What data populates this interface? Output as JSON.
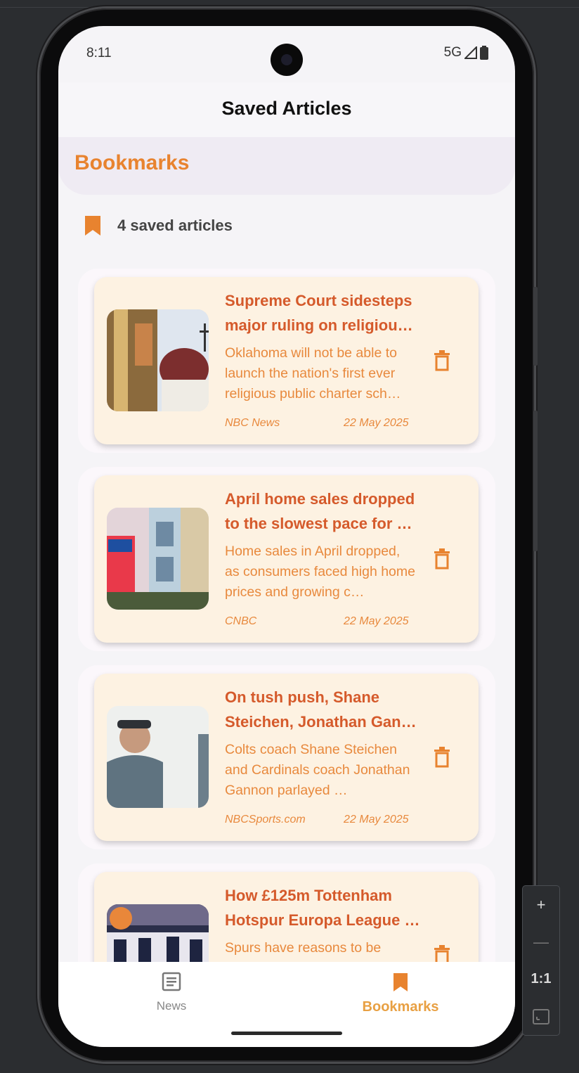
{
  "status_bar": {
    "time": "8:11",
    "network": "5G"
  },
  "app_bar": {
    "title": "Saved Articles"
  },
  "section": {
    "title": "Bookmarks",
    "count_label": "4 saved articles"
  },
  "articles": [
    {
      "title": "Supreme Court sidesteps major ruling on religiou…",
      "description": "Oklahoma will not be able to launch the nation's first ever religious public charter sch…",
      "source": "NBC News",
      "date": "22 May 2025"
    },
    {
      "title": "April home sales dropped to the slowest pace for …",
      "description": "Home sales in April dropped, as consumers faced high home prices and growing c…",
      "source": "CNBC",
      "date": "22 May 2025"
    },
    {
      "title": "On tush push, Shane Steichen, Jonathan Gan…",
      "description": "Colts coach Shane Steichen and Cardinals coach Jonathan Gannon parlayed …",
      "source": "NBCSports.com",
      "date": "22 May 2025"
    },
    {
      "title": "How £125m Tottenham Hotspur Europa League …",
      "description": "Spurs have reasons to be",
      "source": "",
      "date": ""
    }
  ],
  "bottom_nav": {
    "news_label": "News",
    "bookmarks_label": "Bookmarks"
  },
  "zoom_controls": {
    "zoom_in": "+",
    "zoom_out": "—",
    "actual_size": "1:1"
  },
  "colors": {
    "accent": "#e8832f",
    "title_text": "#d55a2b",
    "card_bg": "#fdf2e2"
  }
}
